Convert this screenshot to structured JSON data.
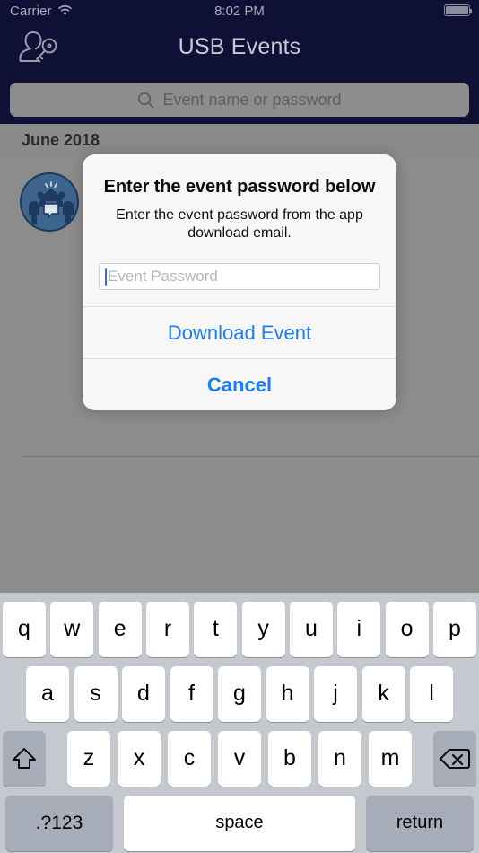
{
  "status_bar": {
    "carrier": "Carrier",
    "wifi_icon": "wifi-icon",
    "time": "8:02 PM",
    "battery_icon": "battery-full-icon"
  },
  "nav_bar": {
    "title": "USB Events",
    "left_icon": "person-key-icon",
    "background_color": "#0f1035",
    "title_color": "#c9c9d4"
  },
  "search": {
    "placeholder": "Event name or password",
    "value": "",
    "icon": "search-icon"
  },
  "list": {
    "section_header": "June 2018",
    "rows": [
      {
        "avatar_icon": "people-house-avatar-icon",
        "title": "",
        "subtitle": ""
      }
    ]
  },
  "alert": {
    "title": "Enter the event password below",
    "message": "Enter the event password from the app download email.",
    "input": {
      "placeholder": "Event Password",
      "value": "",
      "caret_color": "#2f6cf6"
    },
    "buttons": [
      {
        "label": "Download Event",
        "style": "normal"
      },
      {
        "label": "Cancel",
        "style": "bold"
      }
    ],
    "tint_color": "#1c7cfa",
    "background_color": "#f7f7f7"
  },
  "keyboard": {
    "row1": [
      "q",
      "w",
      "e",
      "r",
      "t",
      "y",
      "u",
      "i",
      "o",
      "p"
    ],
    "row2": [
      "a",
      "s",
      "d",
      "f",
      "g",
      "h",
      "j",
      "k",
      "l"
    ],
    "row3": [
      "z",
      "x",
      "c",
      "v",
      "b",
      "n",
      "m"
    ],
    "shift_icon": "shift-arrow-icon",
    "delete_icon": "backspace-icon",
    "numbers_key": ".?123",
    "space_key": "space",
    "return_key": "return",
    "background_color": "#c5c8ce"
  }
}
